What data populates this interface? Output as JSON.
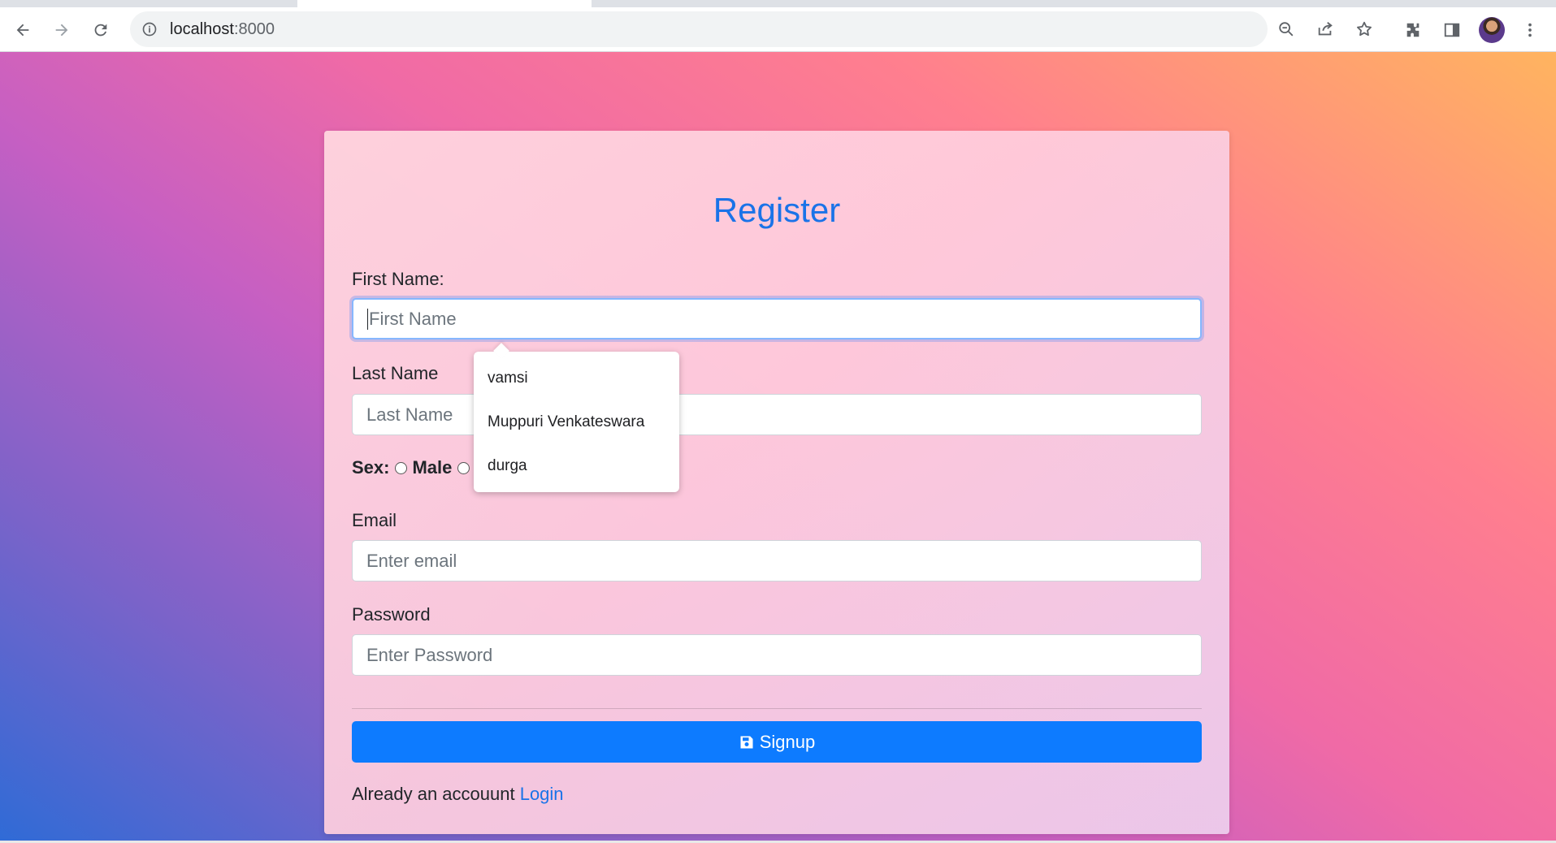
{
  "browser": {
    "url_host": "localhost",
    "url_port": ":8000"
  },
  "form": {
    "title": "Register",
    "first_name": {
      "label": "First Name:",
      "placeholder": "First Name"
    },
    "last_name": {
      "label": "Last Name",
      "placeholder": "Last Name"
    },
    "sex": {
      "label": "Sex:",
      "option_male": "Male"
    },
    "email": {
      "label": "Email",
      "placeholder": "Enter email"
    },
    "password": {
      "label": "Password",
      "placeholder": "Enter Password"
    },
    "signup_label": "Signup",
    "already_text": "Already an accouunt",
    "login_label": "Login"
  },
  "autofill": {
    "items": [
      "vamsi",
      "Muppuri Venkateswara",
      "durga"
    ]
  },
  "colors": {
    "accent": "#1a73e8",
    "button": "#0d7bff"
  }
}
